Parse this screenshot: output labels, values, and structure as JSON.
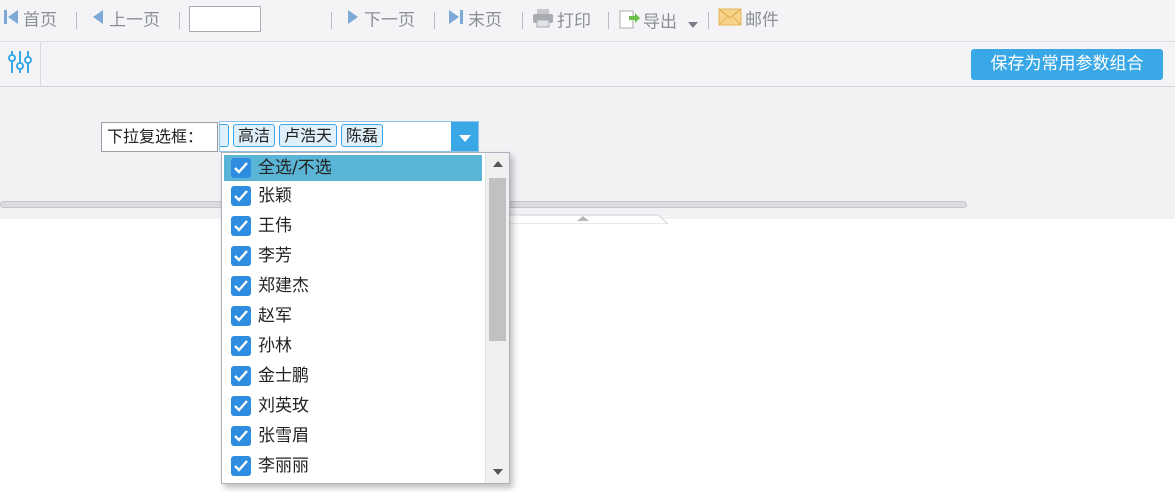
{
  "toolbar": {
    "first": "首页",
    "prev": "上一页",
    "page_input_value": "",
    "next": "下一页",
    "last": "末页",
    "print": "打印",
    "export": "导出",
    "mail": "邮件"
  },
  "param_bar": {
    "save_label": "保存为常用参数组合"
  },
  "form": {
    "field_label": "下拉复选框：",
    "selected_chips": [
      "",
      "高洁",
      "卢浩天",
      "陈磊"
    ],
    "options": [
      {
        "label": "全选/不选",
        "checked": true,
        "highlighted": true
      },
      {
        "label": "张颖",
        "checked": true
      },
      {
        "label": "王伟",
        "checked": true
      },
      {
        "label": "李芳",
        "checked": true
      },
      {
        "label": "郑建杰",
        "checked": true
      },
      {
        "label": "赵军",
        "checked": true
      },
      {
        "label": "孙林",
        "checked": true
      },
      {
        "label": "金士鹏",
        "checked": true
      },
      {
        "label": "刘英玫",
        "checked": true
      },
      {
        "label": "张雪眉",
        "checked": true
      },
      {
        "label": "李丽丽",
        "checked": true
      }
    ]
  },
  "colors": {
    "accent": "#3aa8e6",
    "highlight": "#5ab4d6",
    "checkbox": "#2e8de0",
    "toolbar_text": "#8a8f97"
  }
}
